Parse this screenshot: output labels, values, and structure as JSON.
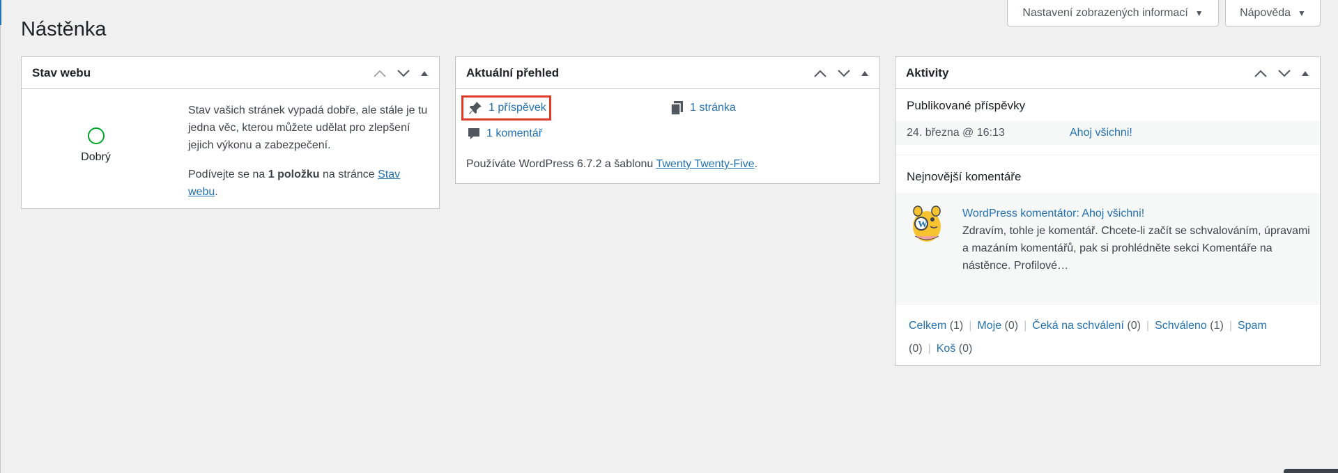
{
  "header": {
    "page_title": "Nástěnka",
    "screen_options_label": "Nastavení zobrazených informací",
    "help_label": "Nápověda"
  },
  "site_health": {
    "title": "Stav webu",
    "status_label": "Dobrý",
    "status_color": "#00a32a",
    "text_1": "Stav vašich stránek vypadá dobře, ale stále je tu jedna věc, kterou můžete udělat pro zlepšení jejich výkonu a zabezpečení.",
    "text_2_before": "Podívejte se na ",
    "text_2_bold": "1 položku",
    "text_2_middle": " na stránce ",
    "text_2_link": "Stav webu",
    "text_2_after": "."
  },
  "glance": {
    "title": "Aktuální přehled",
    "posts_label": "1 příspěvek",
    "pages_label": "1 stránka",
    "comments_label": "1 komentář",
    "footer_before": "Používáte WordPress 6.7.2 a šablonu ",
    "footer_theme": "Twenty Twenty-Five",
    "footer_after": ".",
    "highlight_color": "#e03a2a"
  },
  "activity": {
    "title": "Aktivity",
    "published_heading": "Publikované příspěvky",
    "post_date": "24. března @ 16:13",
    "post_title": "Ahoj všichni!",
    "comments_heading": "Nejnovější komentáře",
    "comment_author_link": "WordPress komentátor: Ahoj všichni!",
    "comment_excerpt": "Zdravím, tohle je komentář. Chcete-li začít se schvalováním, úpravami a mazáním komentářů, pak si prohlédněte sekci Komentáře na nástěnce. Profilové…",
    "links": [
      {
        "label": "Celkem",
        "count": "(1)"
      },
      {
        "label": "Moje",
        "count": "(0)"
      },
      {
        "label": "Čeká na schválení",
        "count": "(0)"
      },
      {
        "label": "Schváleno",
        "count": "(1)"
      },
      {
        "label": "Spam",
        "count": "(0)"
      },
      {
        "label": "Koš",
        "count": "(0)"
      }
    ]
  },
  "colors": {
    "link": "#2271b1",
    "background": "#f0f0f1",
    "border": "#c3c4c7"
  }
}
